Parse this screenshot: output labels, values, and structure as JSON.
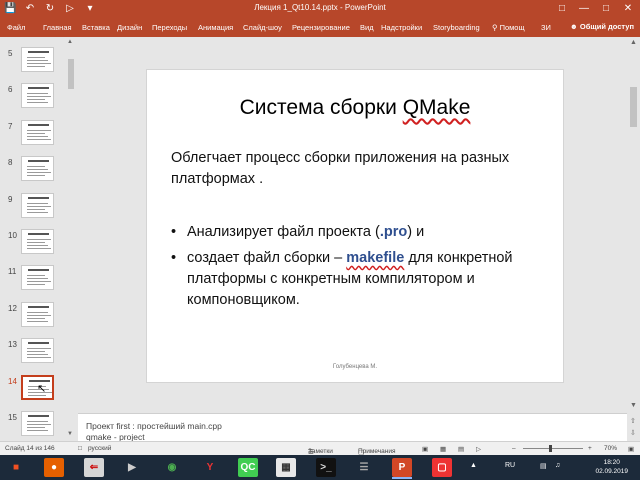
{
  "window": {
    "title": "Лекция 1_Qt10.14.pptx - PowerPoint"
  },
  "ribbon": {
    "tabs": [
      "Файл",
      "Главная",
      "Вставка",
      "Дизайн",
      "Переходы",
      "Анимация",
      "Слайд-шоу",
      "Рецензирование",
      "Вид",
      "Надстройки",
      "Storyboarding"
    ],
    "help": "Помощ",
    "extra_tab": "ЗИ",
    "share": "Общий доступ"
  },
  "thumbnails": {
    "numbers": [
      "5",
      "6",
      "7",
      "8",
      "9",
      "10",
      "11",
      "12",
      "13",
      "14",
      "15"
    ],
    "active": "14"
  },
  "slide": {
    "title_prefix": "Система сборки ",
    "title_word": "QMake",
    "intro": "Облегчает процесс сборки приложения на разных платформах .",
    "bullet1_pre": "Анализирует файл проекта (",
    "bullet1_kw": ".pro",
    "bullet1_post": ") и",
    "bullet2_pre": "создает файл сборки – ",
    "bullet2_kw": "makefile",
    "bullet2_post": "  для конкретной платформы с конкретным компилятором и компоновщиком.",
    "footer": "Голубенцева М."
  },
  "notes": {
    "line1": "Проект  first :  простейший main.cpp",
    "line2": "qmake - project"
  },
  "status": {
    "slide_info": "Слайд 14 из 146",
    "language": "русский",
    "notes_btn": "Заметки",
    "comments_btn": "Примечания",
    "zoom": "70%"
  },
  "taskbar": {
    "lang": "RU",
    "time": "18:20",
    "date": "02.09.2019"
  },
  "colors": {
    "accent": "#b7472a",
    "keyword": "#2f4f8f",
    "active_thumb": "#c43e1c"
  }
}
